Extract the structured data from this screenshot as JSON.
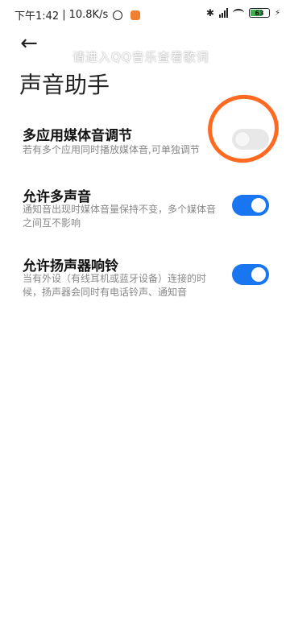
{
  "status_bar": {
    "time": "下午1:42",
    "separator": "|",
    "speed": "10.8K/s",
    "battery": "63",
    "bluetooth": "bluetooth-icon",
    "signal": "signal-icon",
    "wifi": "wifi-icon"
  },
  "header": {
    "back": "back-arrow-icon",
    "overlay_text": "请进入QQ音乐查看歌词",
    "title": "声音助手"
  },
  "settings": [
    {
      "title": "多应用媒体音调节",
      "description": "若有多个应用同时播放媒体音,可单独调节",
      "enabled": false
    },
    {
      "title": "允许多声音",
      "description": "通知音出现时媒体音量保持不变，多个媒体音之间互不影响",
      "enabled": true
    },
    {
      "title": "允许扬声器响铃",
      "description": "当有外设（有线耳机或蓝牙设备）连接的时候，扬声器会同时有电话铃声、通知音",
      "enabled": true
    }
  ],
  "colors": {
    "toggle_on": "#1a76f0",
    "annotation": "#ff6a22"
  }
}
